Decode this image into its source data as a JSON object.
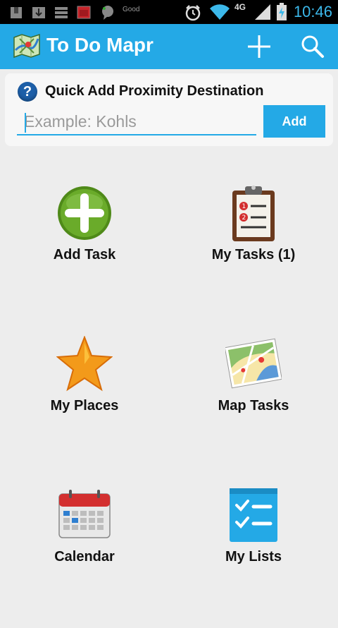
{
  "status_bar": {
    "time": "10:46",
    "network": "4G",
    "notification_text": "Good",
    "icons": [
      "shield-icon",
      "download-icon",
      "menu-list-icon",
      "calendar-icon",
      "chat-icon",
      "alarm-icon",
      "wifi-icon",
      "signal-icon",
      "battery-icon"
    ]
  },
  "action_bar": {
    "title": "To Do Mapr",
    "add_icon": "plus-icon",
    "search_icon": "search-icon"
  },
  "quick_add": {
    "title": "Quick Add Proximity Destination",
    "help_glyph": "?",
    "placeholder": "Example: Kohls",
    "value": "",
    "button_label": "Add"
  },
  "tiles": [
    {
      "label": "Add Task",
      "icon": "add-circle-icon"
    },
    {
      "label": "My Tasks (1)",
      "icon": "clipboard-icon"
    },
    {
      "label": "My Places",
      "icon": "star-icon"
    },
    {
      "label": "Map Tasks",
      "icon": "map-icon"
    },
    {
      "label": "Calendar",
      "icon": "calendar-icon"
    },
    {
      "label": "My Lists",
      "icon": "checklist-icon"
    }
  ],
  "colors": {
    "accent": "#24a9e6",
    "background": "#ededed",
    "green": "#5a9a1d",
    "orange": "#f39a1a"
  }
}
